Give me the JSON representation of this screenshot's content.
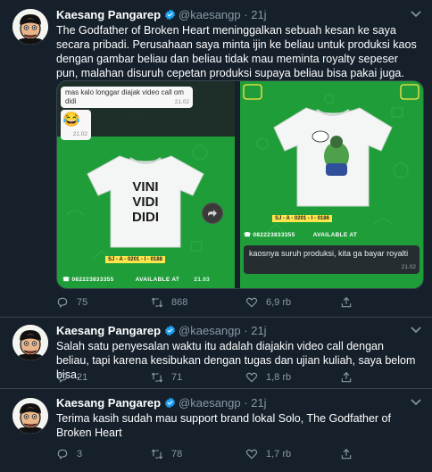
{
  "tweets": [
    {
      "name": "Kaesang Pangarep",
      "handle": "@kaesangp",
      "sep": "·",
      "time": "21j",
      "text": "The Godfather of Broken Heart meninggalkan sebuah kesan ke saya secara pribadi. Perusahaan saya minta ijin ke beliau untuk produksi kaos dengan gambar beliau dan beliau tidak mau meminta royalty sepeser pun, malahan disuruh cepetan produksi supaya beliau bisa pakai juga.",
      "replies": "75",
      "retweets": "868",
      "likes": "6,9 rb"
    },
    {
      "name": "Kaesang Pangarep",
      "handle": "@kaesangp",
      "sep": "·",
      "time": "21j",
      "text": "Salah satu penyesalan waktu itu adalah diajakin video call dengan beliau, tapi karena kesibukan dengan tugas dan ujian kuliah, saya belom bisa.",
      "replies": "21",
      "retweets": "71",
      "likes": "1,8 rb"
    },
    {
      "name": "Kaesang Pangarep",
      "handle": "@kaesangp",
      "sep": "·",
      "time": "21j",
      "text": "Terima kasih sudah mau support brand lokal Solo, The Godfather of Broken Heart",
      "replies": "3",
      "retweets": "78",
      "likes": "1,7 rb"
    }
  ],
  "media": {
    "left": {
      "message": "mas kalo longgar diajak video call om didi",
      "message_time": "21.02",
      "emoji": "😂",
      "emoji_time": "21.02",
      "shirt_text": [
        "VINI",
        "VIDI",
        "DIDI"
      ],
      "sku": "SJ - A - 0201 - I - 0188",
      "phone": "☎ 082223833355",
      "brand": "AVAILABLE AT",
      "time": "21.03"
    },
    "right": {
      "sku": "SJ - A - 0201 - I - 0186",
      "phone": "☎ 082223833355",
      "brand": "AVAILABLE AT",
      "caption": "kaosnya suruh produksi, kita ga bayar royalti",
      "caption_time": "21.02"
    }
  },
  "colors": {
    "background": "#15202b",
    "muted": "#8899a6",
    "verified": "#1da1f2",
    "shot_green": "#1f9d39"
  }
}
